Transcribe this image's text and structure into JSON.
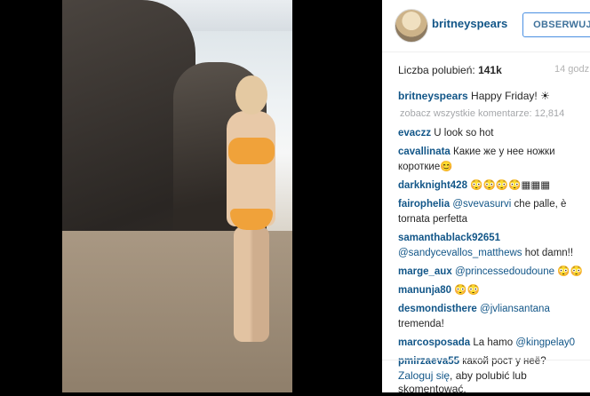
{
  "post": {
    "username": "britneyspears",
    "follow_label": "OBSERWUJ",
    "likes_label": "Liczba polubień:",
    "likes_value": "141k",
    "time": "14 godz",
    "caption_text": "Happy Friday! ☀",
    "load_more": "zobacz wszystkie komentarze: 12,814"
  },
  "comments": [
    {
      "user": "evaczz",
      "text": "U look so hot"
    },
    {
      "user": "cavallinata",
      "text": "Какие же у нее ножки короткие😊"
    },
    {
      "user": "darkknight428",
      "text": "😳😳😳😳▦▦▦"
    },
    {
      "user": "fairophelia",
      "mention": "@svevasurvi",
      "text": " che palle, è tornata perfetta"
    },
    {
      "user": "samanthablack92651",
      "mention": "@sandycevallos_matthews",
      "text": " hot damn!!"
    },
    {
      "user": "marge_aux",
      "mention": "@princessedoudoune",
      "text": " 😳😳"
    },
    {
      "user": "manunja80",
      "text": "😳😳"
    },
    {
      "user": "desmondisthere",
      "mention": "@jvliansantana",
      "text": " tremenda!"
    },
    {
      "user": "marcosposada",
      "text": "La hamo ",
      "mention_after": "@kingpelay0"
    },
    {
      "user": "pmirzaeva55",
      "text": "какой рост у неё?"
    }
  ],
  "footer": {
    "login_link": "Zaloguj się",
    "login_rest": ", aby polubić lub skomentować."
  }
}
